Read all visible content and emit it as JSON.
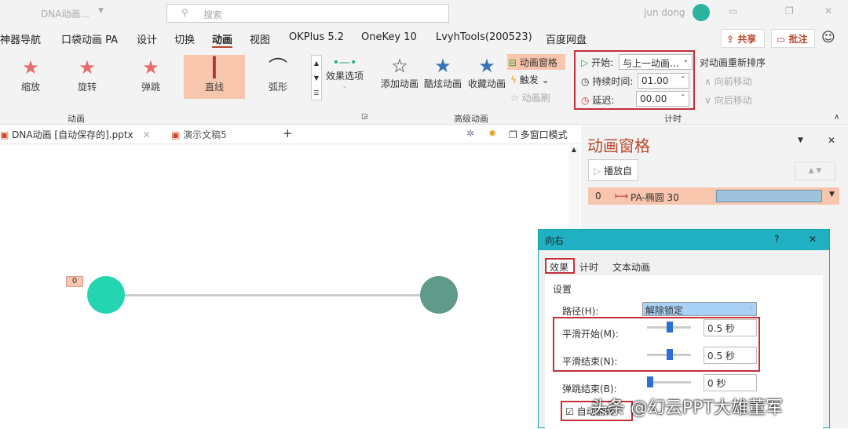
{
  "titlebar": {
    "doc_name": "DNA动画...",
    "search_placeholder": "搜索",
    "user": "jun dong"
  },
  "menu_tabs": [
    "神器导航",
    "口袋动画 PA",
    "设计",
    "切换",
    "动画",
    "视图",
    "OKPlus 5.2",
    "OneKey 10",
    "LvyhTools(200523)",
    "百度网盘"
  ],
  "share_button": "共享",
  "comment_button": "批注",
  "animation_group": {
    "items": [
      "缩放",
      "旋转",
      "弹跳",
      "直线",
      "弧形"
    ],
    "effect_options": "效果选项",
    "label": "动画"
  },
  "advanced_group": {
    "add": "添加动画",
    "cool": "酷炫动画",
    "fav": "收藏动画",
    "pane": "动画窗格",
    "trigger": "触发",
    "painter": "动画刷",
    "label": "高级动画"
  },
  "timing_group": {
    "start_label": "开始:",
    "start_value": "与上一动画...",
    "duration_label": "持续时间:",
    "duration_value": "01.00",
    "delay_label": "延迟:",
    "delay_value": "00.00",
    "reorder": "对动画重新排序",
    "move_earlier": "向前移动",
    "move_later": "向后移动",
    "label": "计时"
  },
  "doc_tabs": [
    "DNA动画  [自动保存的].pptx",
    "演示文稿5"
  ],
  "multi_window": "多窗口模式",
  "slide": {
    "tag": "0"
  },
  "anim_pane": {
    "title": "动画窗格",
    "play_from": "播放自",
    "item_index": "0",
    "item_name": "PA-椭圆 30"
  },
  "dialog": {
    "title": "向右",
    "help": "?",
    "tabs": [
      "效果",
      "计时",
      "文本动画"
    ],
    "section": "设置",
    "path_label": "路径(H):",
    "path_value": "解除锁定",
    "smooth_start_label": "平滑开始(M):",
    "smooth_start_value": "0.5 秒",
    "smooth_end_label": "平滑结束(N):",
    "smooth_end_value": "0.5 秒",
    "bounce_end_label": "弹跳结束(B):",
    "bounce_end_value": "0 秒",
    "auto_reverse_label": "自动翻转"
  },
  "watermark": "头条 @幻云PPT大雄董军"
}
